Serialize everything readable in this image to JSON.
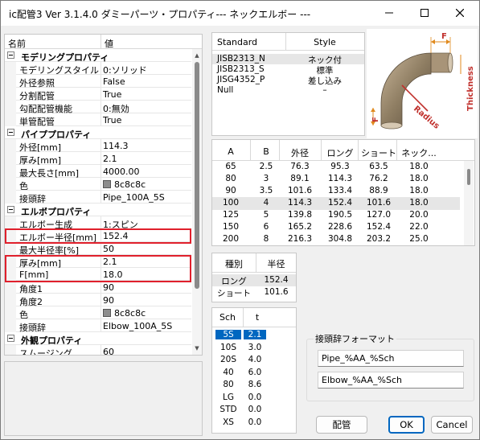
{
  "window": {
    "title": "ic配管3 Ver 3.1.4.0 ダミーパーツ・プロパティ--- ネックエルボー ---"
  },
  "propgrid": {
    "col_name": "名前",
    "col_value": "値",
    "rows": [
      {
        "type": "cat",
        "label": "モデリングプロパティ"
      },
      {
        "type": "prop",
        "label": "モデリングスタイル",
        "value": "0:ソリッド"
      },
      {
        "type": "prop",
        "label": "外径参照",
        "value": "False"
      },
      {
        "type": "prop",
        "label": "分割配管",
        "value": "True"
      },
      {
        "type": "prop",
        "label": "勾配配管機能",
        "value": "0:無効"
      },
      {
        "type": "prop",
        "label": "単管配管",
        "value": "True"
      },
      {
        "type": "cat",
        "label": "パイププロパティ"
      },
      {
        "type": "prop",
        "label": "外径[mm]",
        "value": "114.3"
      },
      {
        "type": "prop",
        "label": "厚み[mm]",
        "value": "2.1"
      },
      {
        "type": "prop",
        "label": "最大長さ[mm]",
        "value": "4000.00"
      },
      {
        "type": "color",
        "label": "色",
        "value": "8c8c8c"
      },
      {
        "type": "prop",
        "label": "接頭辞",
        "value": "Pipe_100A_5S"
      },
      {
        "type": "cat",
        "label": "エルボプロパティ"
      },
      {
        "type": "prop",
        "label": "エルボー生成",
        "value": "1:スピン"
      },
      {
        "type": "prop",
        "label": "エルボー半径[mm]",
        "value": "152.4"
      },
      {
        "type": "prop",
        "label": "最大半径率[%]",
        "value": "50"
      },
      {
        "type": "prop",
        "label": "厚み[mm]",
        "value": "2.1"
      },
      {
        "type": "prop",
        "label": "F[mm]",
        "value": "18.0"
      },
      {
        "type": "prop",
        "label": "角度1",
        "value": "90"
      },
      {
        "type": "prop",
        "label": "角度2",
        "value": "90"
      },
      {
        "type": "color",
        "label": "色",
        "value": "8c8c8c"
      },
      {
        "type": "prop",
        "label": "接頭辞",
        "value": "Elbow_100A_5S"
      },
      {
        "type": "cat",
        "label": "外観プロパティ"
      },
      {
        "type": "prop",
        "label": "スムージング",
        "value": "60"
      }
    ]
  },
  "standards": {
    "col_standard": "Standard",
    "col_style": "Style",
    "rows": [
      {
        "standard": "JISB2313_N",
        "style": "ネック付",
        "selected": true
      },
      {
        "standard": "JISB2313_S",
        "style": "標準",
        "selected": false
      },
      {
        "standard": "JISG4352_P",
        "style": "差し込み",
        "selected": false
      },
      {
        "standard": "Null",
        "style": "–",
        "selected": false
      }
    ]
  },
  "diagram": {
    "label_f_top": "F",
    "label_f_left": "F",
    "label_radius": "Radius",
    "label_thickness": "Thickness"
  },
  "dimensions": {
    "headers": [
      "A",
      "B",
      "外径",
      "ロング",
      "ショート",
      "ネック..."
    ],
    "rows": [
      [
        "65",
        "2.5",
        "76.3",
        "95.3",
        "63.5",
        "18.0"
      ],
      [
        "80",
        "3",
        "89.1",
        "114.3",
        "76.2",
        "18.0"
      ],
      [
        "90",
        "3.5",
        "101.6",
        "133.4",
        "88.9",
        "18.0"
      ],
      [
        "100",
        "4",
        "114.3",
        "152.4",
        "101.6",
        "18.0"
      ],
      [
        "125",
        "5",
        "139.8",
        "190.5",
        "127.0",
        "20.0"
      ],
      [
        "150",
        "6",
        "165.2",
        "228.6",
        "152.4",
        "22.0"
      ],
      [
        "200",
        "8",
        "216.3",
        "304.8",
        "203.2",
        "25.0"
      ]
    ],
    "selected_index": 3
  },
  "radius_types": {
    "col_kind": "種別",
    "col_radius": "半径",
    "rows": [
      {
        "kind": "ロング",
        "radius": "152.4",
        "selected": true
      },
      {
        "kind": "ショート",
        "radius": "101.6",
        "selected": false
      }
    ]
  },
  "schedules": {
    "col_sch": "Sch",
    "col_t": "t",
    "rows": [
      {
        "sch": "5S",
        "t": "2.1",
        "selected": true
      },
      {
        "sch": "10S",
        "t": "3.0",
        "selected": false
      },
      {
        "sch": "20S",
        "t": "4.0",
        "selected": false
      },
      {
        "sch": "40",
        "t": "6.0",
        "selected": false
      },
      {
        "sch": "80",
        "t": "8.6",
        "selected": false
      },
      {
        "sch": "LG",
        "t": "0.0",
        "selected": false
      },
      {
        "sch": "STD",
        "t": "0.0",
        "selected": false
      },
      {
        "sch": "XS",
        "t": "0.0",
        "selected": false
      }
    ]
  },
  "prefix_format": {
    "group_title": "接頭辞フォーマット",
    "pipe_value": "Pipe_%AA_%Sch",
    "elbow_value": "Elbow_%AA_%Sch"
  },
  "buttons": {
    "layout": "配管",
    "ok": "OK",
    "cancel": "Cancel"
  },
  "colors": {
    "highlight": "#e0202c",
    "selection": "#0067c0",
    "swatch": "#8c8c8c",
    "dimension_orange": "#e08a1e",
    "diagram_red": "#c0302c"
  }
}
